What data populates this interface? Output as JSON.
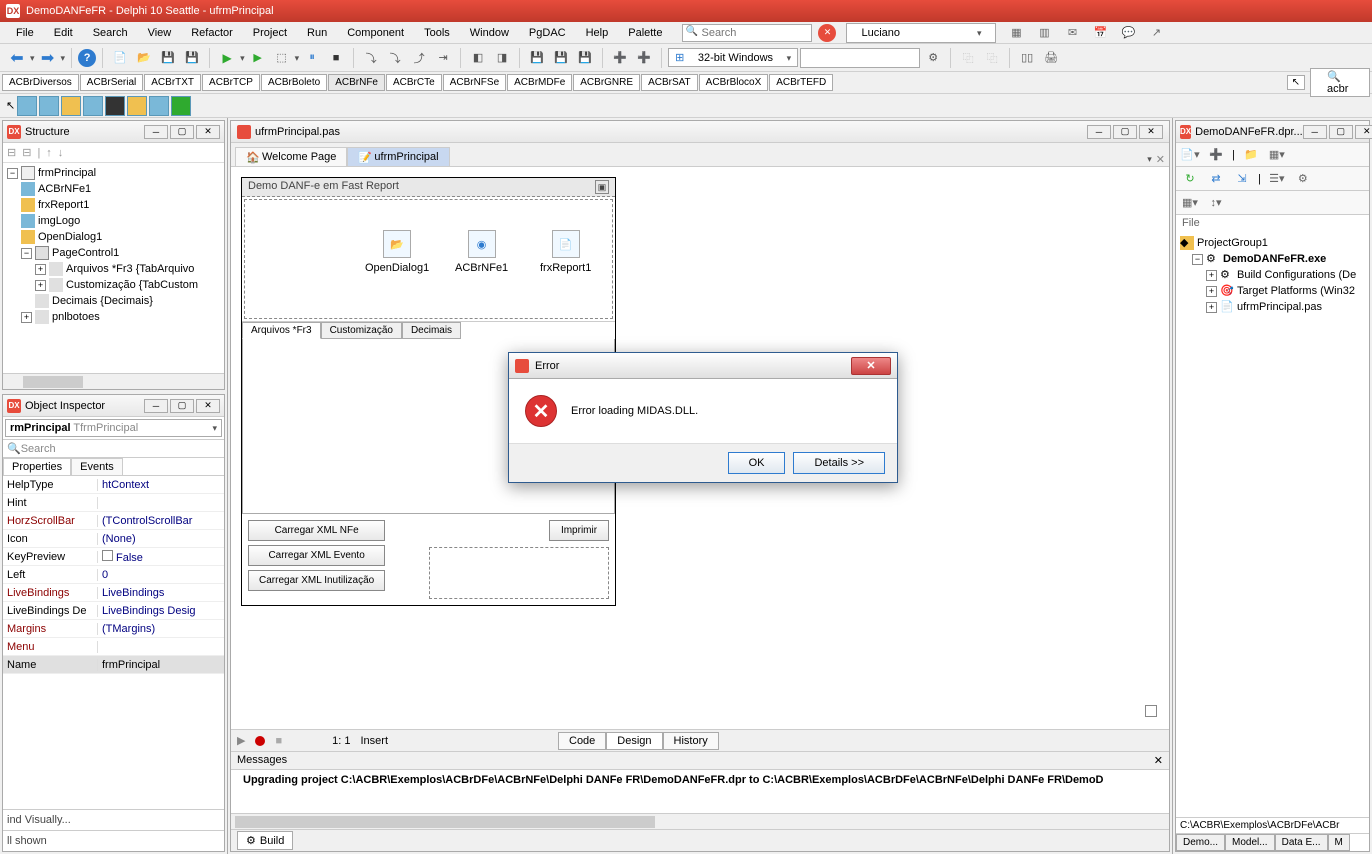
{
  "window_title": "DemoDANFeFR - Delphi 10 Seattle - ufrmPrincipal",
  "menu": [
    "File",
    "Edit",
    "Search",
    "View",
    "Refactor",
    "Project",
    "Run",
    "Component",
    "Tools",
    "Window",
    "PgDAC",
    "Help",
    "Palette"
  ],
  "search_placeholder": "Search",
  "user_combo": "Luciano",
  "platform_combo": "32-bit Windows",
  "component_tabs": [
    "ACBrDiversos",
    "ACBrSerial",
    "ACBrTXT",
    "ACBrTCP",
    "ACBrBoleto",
    "ACBrNFe",
    "ACBrCTe",
    "ACBrNFSe",
    "ACBrMDFe",
    "ACBrGNRE",
    "ACBrSAT",
    "ACBrBlocoX",
    "ACBrTEFD"
  ],
  "component_tabs_active": "ACBrNFe",
  "palette_search": "acbr",
  "structure": {
    "title": "Structure",
    "root": "frmPrincipal",
    "items": [
      "ACBrNFe1",
      "frxReport1",
      "imgLogo",
      "OpenDialog1",
      "PageControl1"
    ],
    "page_children": [
      "Arquivos *Fr3 {TabArquivo",
      "Customização {TabCustom",
      "Decimais {Decimais}"
    ],
    "last": "pnlbotoes"
  },
  "oi": {
    "title": "Object Inspector",
    "combo_name": "rmPrincipal",
    "combo_type": "TfrmPrincipal",
    "search_placeholder": "Search",
    "tabs": [
      "Properties",
      "Events"
    ],
    "props": [
      {
        "name": "HelpType",
        "val": "htContext"
      },
      {
        "name": "Hint",
        "val": ""
      },
      {
        "name": "HorzScrollBar",
        "val": "(TControlScrollBar",
        "link": true
      },
      {
        "name": "Icon",
        "val": "(None)"
      },
      {
        "name": "KeyPreview",
        "val": "False",
        "chk": true
      },
      {
        "name": "Left",
        "val": "0"
      },
      {
        "name": "LiveBindings",
        "val": "LiveBindings",
        "link": true
      },
      {
        "name": "LiveBindings De",
        "val": "LiveBindings Desig"
      },
      {
        "name": "Margins",
        "val": "(TMargins)",
        "link": true
      },
      {
        "name": "Menu",
        "val": "",
        "link": true
      },
      {
        "name": "Name",
        "val": "frmPrincipal",
        "sel": true
      }
    ],
    "status1": "ind Visually...",
    "status2": "ll shown"
  },
  "editor": {
    "file": "ufrmPrincipal.pas",
    "tabs": [
      "Welcome Page",
      "ufrmPrincipal"
    ],
    "form_title": "Demo DANF-e em Fast Report",
    "components": [
      {
        "name": "OpenDialog1",
        "icon": "📂"
      },
      {
        "name": "ACBrNFe1",
        "icon": "◉"
      },
      {
        "name": "frxReport1",
        "icon": "📄"
      }
    ],
    "page_tabs": [
      "Arquivos *Fr3",
      "Customização",
      "Decimais"
    ],
    "buttons": [
      "Carregar XML NFe",
      "Carregar XML Evento",
      "Carregar XML Inutilização"
    ],
    "print_btn": "Imprimir",
    "cursor": "1:   1",
    "mode": "Insert",
    "view_tabs": [
      "Code",
      "Design",
      "History"
    ],
    "messages_title": "Messages",
    "message": "Upgrading project C:\\ACBR\\Exemplos\\ACBrDFe\\ACBrNFe\\Delphi DANFe FR\\DemoDANFeFR.dpr to C:\\ACBR\\Exemplos\\ACBrDFe\\ACBrNFe\\Delphi DANFe FR\\DemoD",
    "build_tab": "Build"
  },
  "project": {
    "title": "DemoDANFeFR.dpr...",
    "file_label": "File",
    "group": "ProjectGroup1",
    "exe": "DemoDANFeFR.exe",
    "items": [
      "Build Configurations (De",
      "Target Platforms (Win32",
      "ufrmPrincipal.pas"
    ],
    "path": "C:\\ACBR\\Exemplos\\ACBrDFe\\ACBr",
    "tabs": [
      "Demo...",
      "Model...",
      "Data E...",
      "M"
    ]
  },
  "error": {
    "title": "Error",
    "message": "Error loading MIDAS.DLL.",
    "ok": "OK",
    "details": "Details >>"
  }
}
